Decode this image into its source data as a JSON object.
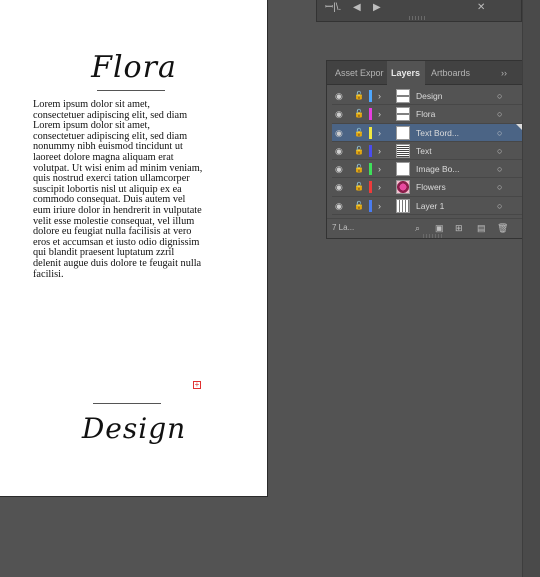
{
  "document": {
    "title_top": "Flora",
    "body": "Lorem ipsum dolor sit amet, consectetuer adipiscing elit, sed diam Lorem ipsum dolor sit amet, consectetuer adipiscing elit, sed diam nonummy nibh euismod tincidunt ut laoreet dolore magna aliquam erat volutpat. Ut wisi enim ad minim veniam, quis nostrud exerci tation ullamcorper suscipit lobortis nisl ut aliquip ex ea commodo consequat. Duis autem vel eum iriure dolor in hendrerit in vulputate velit esse molestie consequat, vel illum dolore eu feugiat nulla facilisis at vero eros et accumsan et iusto odio dignissim qui blandit praesent luptatum zzril delenit augue duis dolore te feugait nulla facilisi.",
    "title_bottom": "Design",
    "overflow_marker": "+"
  },
  "top_panel": {
    "icon_library": "library-icon",
    "icon_prev": "prev-icon",
    "icon_next": "next-icon",
    "icon_tools": "tools-icon"
  },
  "layers_panel": {
    "tabs": [
      "Asset Expor",
      "Layers",
      "Artboards"
    ],
    "active_tab": "Layers",
    "overflow_menu": "››",
    "menu_icon": "≡",
    "rows": [
      {
        "name": "Design",
        "color": "#4ea7ff",
        "thumb": "script"
      },
      {
        "name": "Flora",
        "color": "#e63ee0",
        "thumb": "script"
      },
      {
        "name": "Text Bord...",
        "color": "#f0e840",
        "thumb": "blank",
        "selected": true
      },
      {
        "name": "Text",
        "color": "#4a4cf0",
        "thumb": "text"
      },
      {
        "name": "Image Bo...",
        "color": "#3ee05a",
        "thumb": "blank"
      },
      {
        "name": "Flowers",
        "color": "#ee3b3b",
        "thumb": "flower"
      },
      {
        "name": "Layer 1",
        "color": "#4a7cf0",
        "thumb": "lines"
      }
    ],
    "footer": {
      "count": "7 La..."
    }
  },
  "colors": {
    "canvas": "#535353",
    "selection": "#4b6485"
  }
}
